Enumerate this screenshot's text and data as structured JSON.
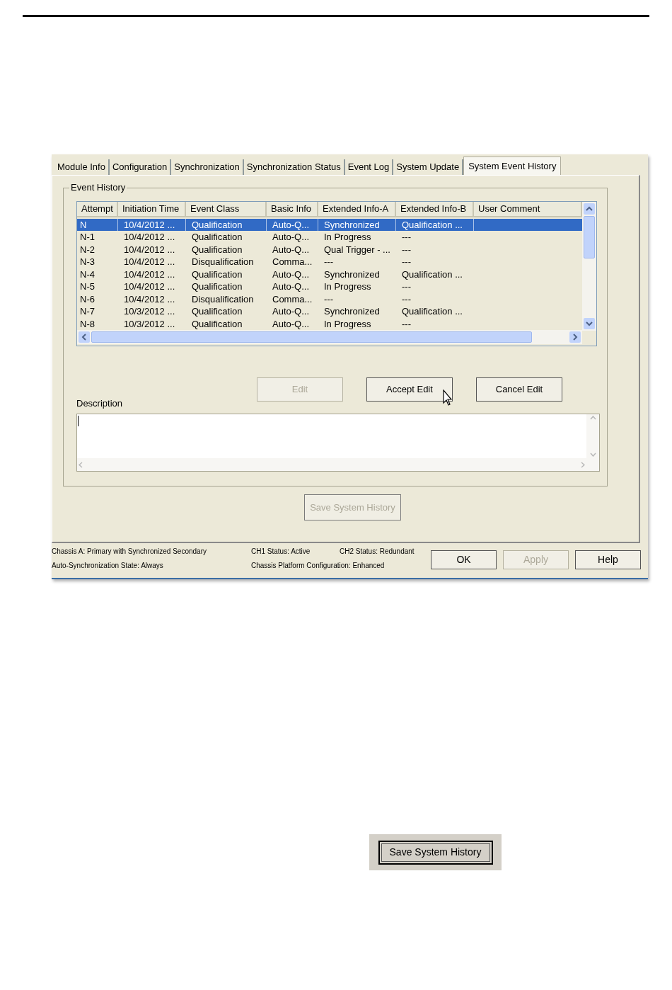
{
  "tabs": [
    {
      "label": "Module Info",
      "selected": false
    },
    {
      "label": "Configuration",
      "selected": false
    },
    {
      "label": "Synchronization",
      "selected": false
    },
    {
      "label": "Synchronization Status",
      "selected": false
    },
    {
      "label": "Event Log",
      "selected": false
    },
    {
      "label": "System Update",
      "selected": false
    },
    {
      "label": "System Event History",
      "selected": true
    }
  ],
  "event_history": {
    "title": "Event History",
    "columns": [
      "Attempt",
      "Initiation Time",
      "Event Class",
      "Basic Info",
      "Extended Info-A",
      "Extended Info-B",
      "User Comment"
    ],
    "rows": [
      {
        "cells": [
          "N",
          "10/4/2012 ...",
          "Qualification",
          "Auto-Q...",
          "Synchronized",
          "Qualification ...",
          ""
        ],
        "selected": true
      },
      {
        "cells": [
          "N-1",
          "10/4/2012 ...",
          "Qualification",
          "Auto-Q...",
          "In Progress",
          "---",
          ""
        ],
        "selected": false
      },
      {
        "cells": [
          "N-2",
          "10/4/2012 ...",
          "Qualification",
          "Auto-Q...",
          "Qual Trigger - ...",
          "---",
          ""
        ],
        "selected": false
      },
      {
        "cells": [
          "N-3",
          "10/4/2012 ...",
          "Disqualification",
          "Comma...",
          "---",
          "---",
          ""
        ],
        "selected": false
      },
      {
        "cells": [
          "N-4",
          "10/4/2012 ...",
          "Qualification",
          "Auto-Q...",
          "Synchronized",
          "Qualification ...",
          ""
        ],
        "selected": false
      },
      {
        "cells": [
          "N-5",
          "10/4/2012 ...",
          "Qualification",
          "Auto-Q...",
          "In Progress",
          "---",
          ""
        ],
        "selected": false
      },
      {
        "cells": [
          "N-6",
          "10/4/2012 ...",
          "Disqualification",
          "Comma...",
          "---",
          "---",
          ""
        ],
        "selected": false
      },
      {
        "cells": [
          "N-7",
          "10/3/2012 ...",
          "Qualification",
          "Auto-Q...",
          "Synchronized",
          "Qualification ...",
          ""
        ],
        "selected": false
      },
      {
        "cells": [
          "N-8",
          "10/3/2012 ...",
          "Qualification",
          "Auto-Q...",
          "In Progress",
          "---",
          ""
        ],
        "selected": false
      }
    ],
    "edit_buttons": [
      {
        "label": "Edit",
        "disabled": true
      },
      {
        "label": "Accept Edit",
        "disabled": false
      },
      {
        "label": "Cancel Edit",
        "disabled": false
      }
    ],
    "description_label": "Description"
  },
  "save_button": {
    "label": "Save System History",
    "disabled": true
  },
  "status": {
    "chassis": "Chassis A: Primary with Synchronized Secondary",
    "ch1": "CH1 Status: Active",
    "ch2": "CH2 Status: Redundant",
    "auto_sync": "Auto-Synchronization State:  Always",
    "platform": "Chassis Platform Configuration:  Enhanced"
  },
  "dialog_buttons": [
    {
      "label": "OK",
      "disabled": false
    },
    {
      "label": "Apply",
      "disabled": true
    },
    {
      "label": "Help",
      "disabled": false
    }
  ],
  "figure_button": {
    "label": "Save System History",
    "disabled": false
  }
}
